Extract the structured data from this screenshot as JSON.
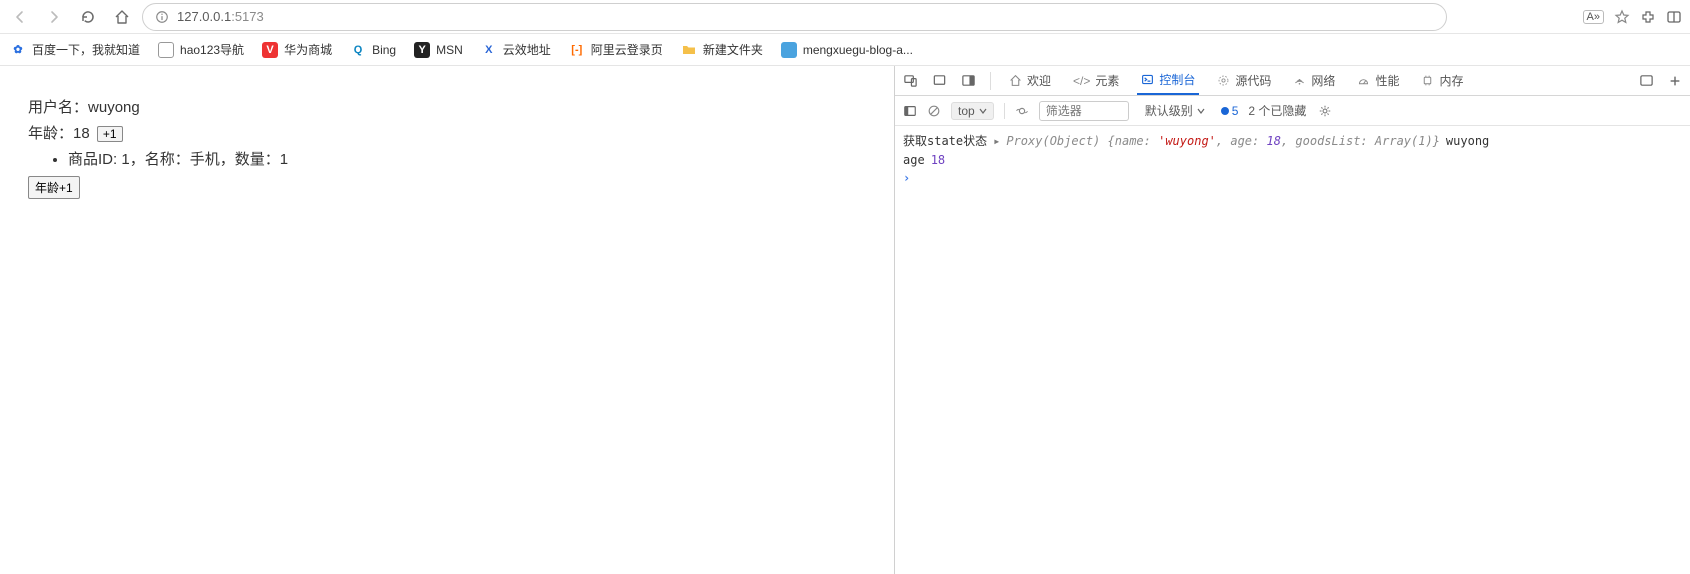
{
  "address_bar": {
    "url_host": "127.0.0.1",
    "url_port": ":5173",
    "reader_badge": "A»"
  },
  "bookmarks": [
    {
      "id": "baidu",
      "label": "百度一下，我就知道",
      "icon": "paw"
    },
    {
      "id": "hao123",
      "label": "hao123导航",
      "icon": "page"
    },
    {
      "id": "huawei",
      "label": "华为商城",
      "icon": "v"
    },
    {
      "id": "bing",
      "label": "Bing",
      "icon": "bing"
    },
    {
      "id": "msn",
      "label": "MSN",
      "icon": "msn"
    },
    {
      "id": "yunxiao",
      "label": "云效地址",
      "icon": "x"
    },
    {
      "id": "aliyun",
      "label": "阿里云登录页",
      "icon": "ali"
    },
    {
      "id": "newfolder",
      "label": "新建文件夹",
      "icon": "folder"
    },
    {
      "id": "blog",
      "label": "mengxuegu-blog-a...",
      "icon": "blog"
    }
  ],
  "page": {
    "username_label": "用户名：",
    "username_value": "wuyong",
    "age_label": "年龄：",
    "age_value": "18",
    "inc_btn": "+1",
    "list_item": {
      "goods_id_label": "商品ID:",
      "goods_id_value": "1",
      "name_label": "名称：",
      "name_value": "手机",
      "qty_label": "数量：",
      "qty_value": "1",
      "sep": "，"
    },
    "age_btn": "年龄+1"
  },
  "devtools": {
    "tabs": {
      "welcome": "欢迎",
      "elements": "元素",
      "console": "控制台",
      "sources": "源代码",
      "network": "网络",
      "performance": "性能",
      "memory": "内存"
    },
    "toolbar": {
      "top": "top",
      "filter_placeholder": "筛选器",
      "level": "默认级别",
      "issues_count": "5",
      "hidden": "2 个已隐藏"
    },
    "console_logs": {
      "line1_prefix": "获取state状态",
      "line1_proxy": "Proxy(Object)",
      "line1_name_k": "name:",
      "line1_name_v": "'wuyong'",
      "line1_age_k": "age:",
      "line1_age_v": "18",
      "line1_goods_k": "goodsList:",
      "line1_goods_v": "Array(1)",
      "line1_trail": "wuyong",
      "line2_key": "age",
      "line2_val": "18"
    }
  }
}
